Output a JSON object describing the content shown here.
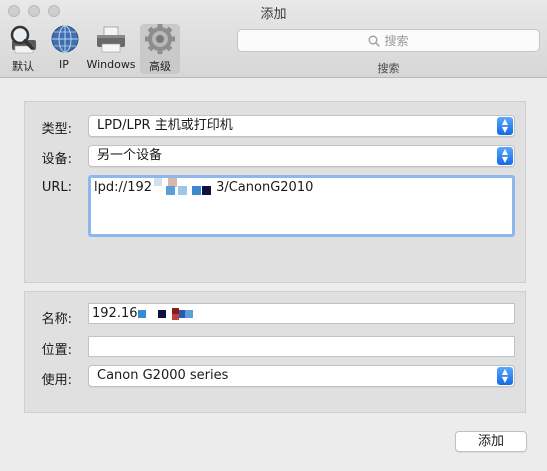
{
  "window": {
    "title": "添加"
  },
  "toolbar": {
    "tools": [
      {
        "label": "默认",
        "icon": "magnifier-printer-icon"
      },
      {
        "label": "IP",
        "icon": "globe-icon"
      },
      {
        "label": "Windows",
        "icon": "windows-printer-icon"
      },
      {
        "label": "高级",
        "icon": "gear-icon"
      }
    ],
    "search": {
      "placeholder": "搜索",
      "caption": "搜索"
    }
  },
  "form": {
    "type": {
      "label": "类型:",
      "value": "LPD/LPR 主机或打印机"
    },
    "device": {
      "label": "设备:",
      "value": "另一个设备"
    },
    "url": {
      "label": "URL:",
      "value_prefix": "lpd://192",
      "value_suffix": "3/CanonG2010"
    },
    "name": {
      "label": "名称:",
      "value_prefix": "192.16"
    },
    "location": {
      "label": "位置:",
      "value": ""
    },
    "use": {
      "label": "使用:",
      "value": "Canon G2000 series"
    }
  },
  "footer": {
    "add_label": "添加"
  },
  "colors": {
    "accent": "#1468e8",
    "focus_ring": "#8db8ef"
  }
}
